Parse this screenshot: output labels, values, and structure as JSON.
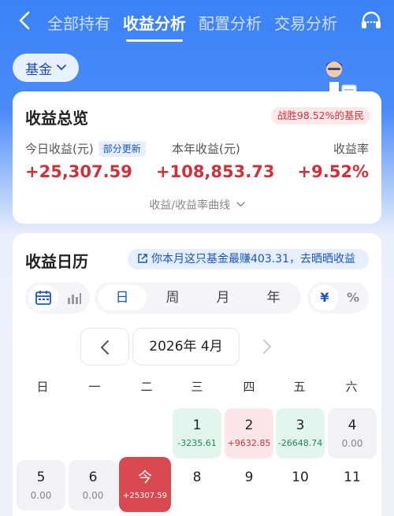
{
  "nav": {
    "back_icon": "chevron-left-icon",
    "tabs": [
      "全部持有",
      "收益分析",
      "配置分析",
      "交易分析"
    ],
    "active_tab": 1,
    "service_icon": "headset-icon"
  },
  "fund_selector": {
    "label": "基金",
    "icon": "chevron-down-icon"
  },
  "overview": {
    "title": "收益总览",
    "badge": "战胜98.52%的基民",
    "today_label": "今日收益(元)",
    "update_tag": "部分更新",
    "today_value": "+25,307.59",
    "year_label": "本年收益(元)",
    "year_value": "+108,853.73",
    "rate_label": "收益率",
    "rate_value": "+9.52%",
    "curve_link": "收益/收益率曲线"
  },
  "calendar": {
    "title": "收益日历",
    "share_text": "你本月这只基金最赚403.31，去晒晒收益",
    "view_icons": [
      "calendar-icon",
      "bar-chart-icon"
    ],
    "periods": [
      "日",
      "周",
      "月",
      "年"
    ],
    "active_period": 0,
    "unit_options": [
      "¥",
      "%"
    ],
    "active_unit": 0,
    "month_label": "2026年 4月",
    "weekdays": [
      "日",
      "一",
      "二",
      "三",
      "四",
      "五",
      "六"
    ],
    "days": [
      {
        "d": "1",
        "v": "-3235.61",
        "kind": "loss"
      },
      {
        "d": "2",
        "v": "+9632.85",
        "kind": "gain"
      },
      {
        "d": "3",
        "v": "-26648.74",
        "kind": "loss"
      },
      {
        "d": "4",
        "v": "0.00",
        "kind": "zero"
      },
      {
        "d": "5",
        "v": "0.00",
        "kind": "zero"
      },
      {
        "d": "6",
        "v": "0.00",
        "kind": "zero"
      },
      {
        "d": "今",
        "v": "+25307.59",
        "kind": "today"
      },
      {
        "d": "8",
        "v": "",
        "kind": "plain"
      },
      {
        "d": "9",
        "v": "",
        "kind": "plain"
      },
      {
        "d": "10",
        "v": "",
        "kind": "plain"
      },
      {
        "d": "11",
        "v": "",
        "kind": "plain"
      }
    ]
  },
  "colors": {
    "brand_blue": "#3b82f6",
    "gain_red": "#d0303a",
    "loss_green": "#1c8a58",
    "today_red": "#d84a4f"
  }
}
